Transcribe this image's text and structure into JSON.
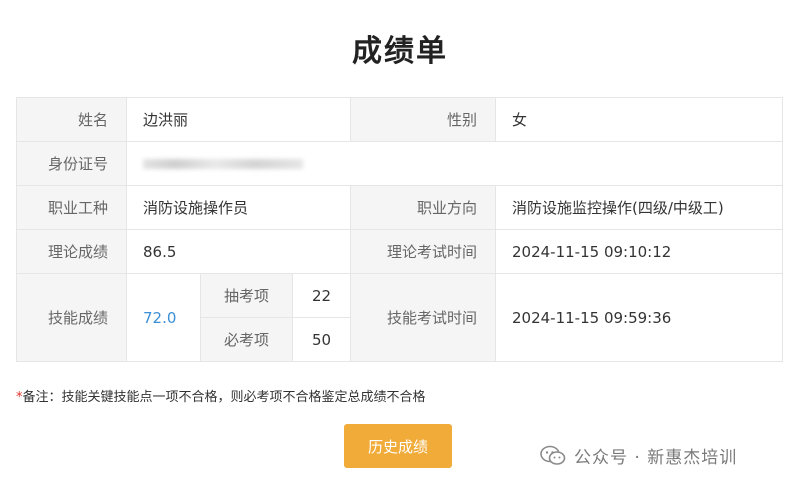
{
  "header": {
    "title": "成绩单"
  },
  "rows": {
    "name_label": "姓名",
    "name_value": "边洪丽",
    "gender_label": "性别",
    "gender_value": "女",
    "id_label": "身份证号",
    "trade_label": "职业工种",
    "trade_value": "消防设施操作员",
    "direction_label": "职业方向",
    "direction_value": "消防设施监控操作(四级/中级工)",
    "theory_score_label": "理论成绩",
    "theory_score_value": "86.5",
    "theory_time_label": "理论考试时间",
    "theory_time_value": "2024-11-15 09:10:12",
    "skill_score_label": "技能成绩",
    "skill_score_value": "72.0",
    "sample_item_label": "抽考项",
    "sample_item_value": "22",
    "required_item_label": "必考项",
    "required_item_value": "50",
    "skill_time_label": "技能考试时间",
    "skill_time_value": "2024-11-15 09:59:36"
  },
  "note": {
    "star": "*",
    "text": "备注：技能关键技能点一项不合格，则必考项不合格鉴定总成绩不合格"
  },
  "actions": {
    "history_label": "历史成绩"
  },
  "watermark": {
    "text": "公众号 · 新惠杰培训",
    "icon": "wechat-icon"
  },
  "colors": {
    "accent_button": "#f0ab38",
    "link": "#3a8fd6",
    "label_bg": "#f5f5f5",
    "required_star": "#e0302a"
  }
}
